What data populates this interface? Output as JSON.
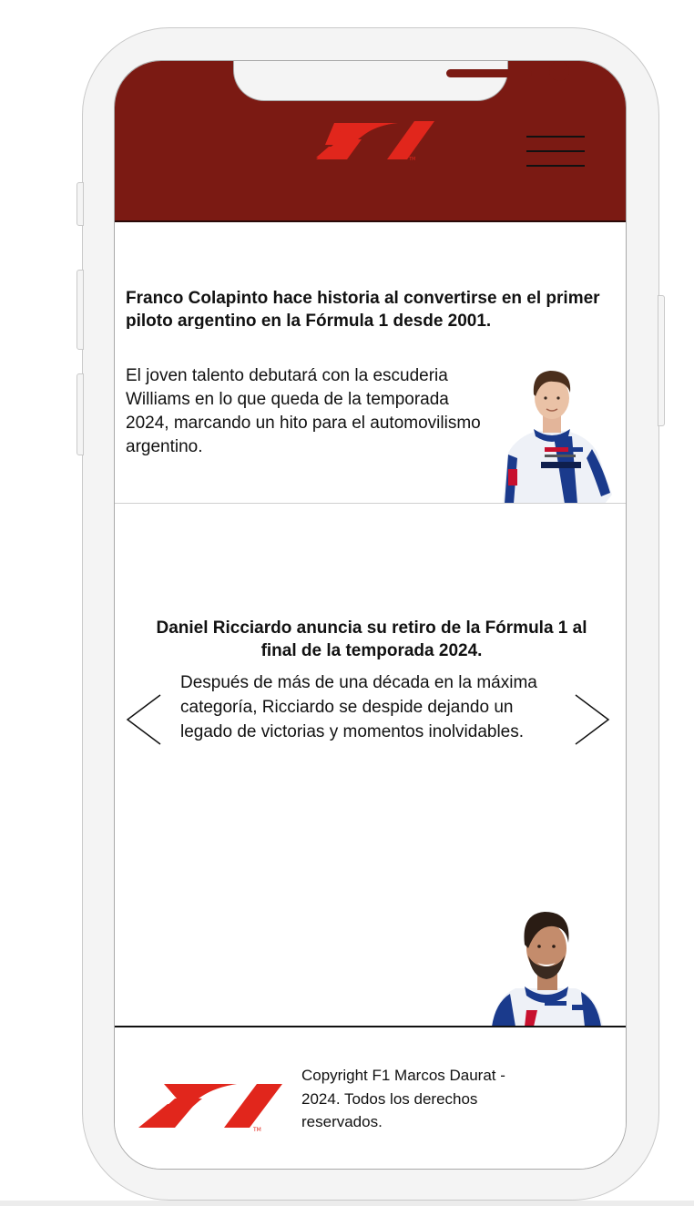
{
  "header": {
    "logo_icon": "f1-logo-icon",
    "menu_icon": "hamburger-menu-icon"
  },
  "news": [
    {
      "title": "Franco Colapinto hace historia al convertirse en el primer piloto argentino en la Fórmula 1 desde 2001.",
      "body": "El joven talento debutará con la escuderia Williams en lo que queda de la temporada 2024, marcando un hito para el automovilismo argentino."
    },
    {
      "title": "Daniel Ricciardo anuncia su retiro de la Fórmula 1 al final de la temporada 2024.",
      "body": "Después de más de una década en la máxima categoría, Ricciardo se despide dejando un legado de victorias y momentos inolvidables."
    }
  ],
  "carousel": {
    "prev_icon": "chevron-left-icon",
    "next_icon": "chevron-right-icon"
  },
  "footer": {
    "copyright": "Copyright F1 Marcos Daurat - 2024. Todos los derechos reservados."
  },
  "colors": {
    "header_bg": "#7b1a13",
    "f1_red": "#e1261c",
    "frame": "#f4f4f4"
  }
}
